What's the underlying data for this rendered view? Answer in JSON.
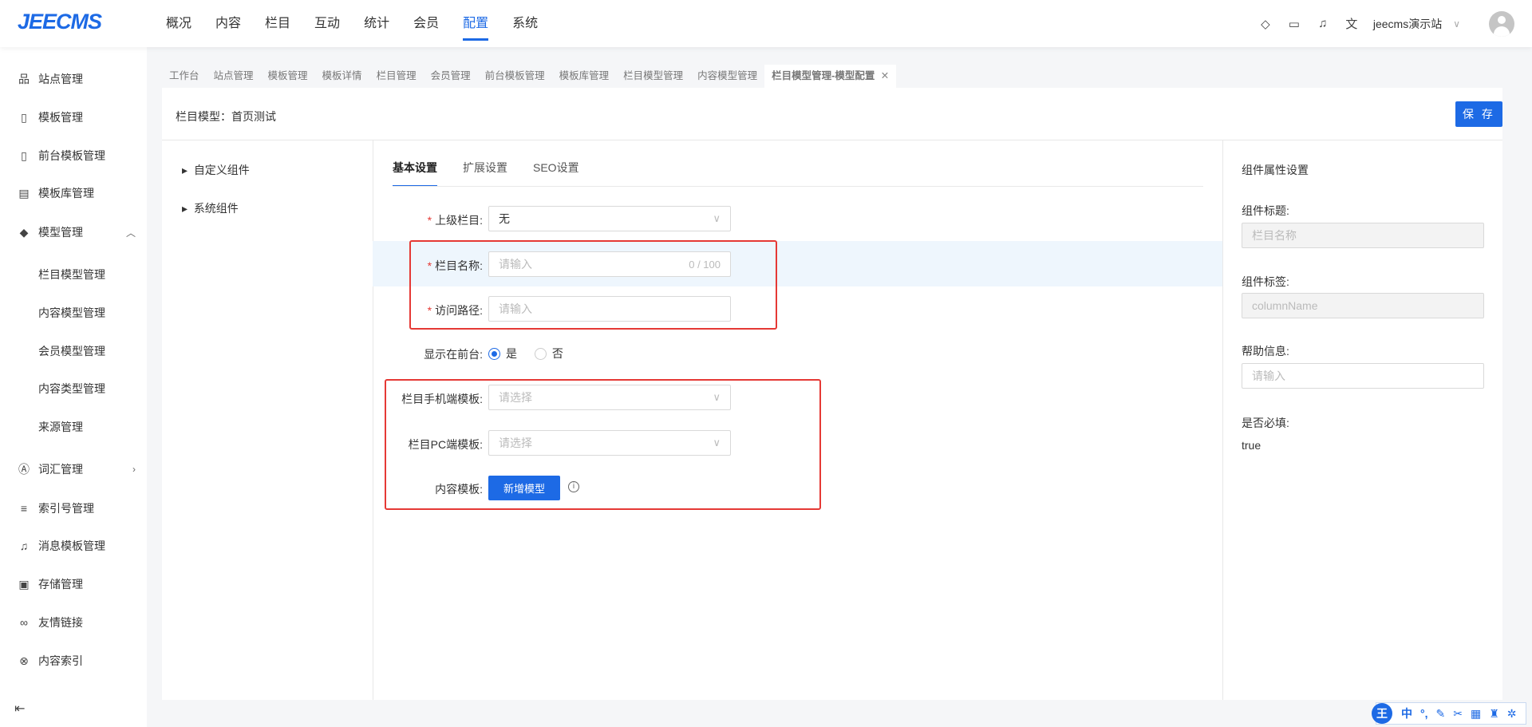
{
  "header": {
    "logo": "JEECMS",
    "nav": [
      "概况",
      "内容",
      "栏目",
      "互动",
      "统计",
      "会员",
      "配置",
      "系统"
    ],
    "active_nav": "配置",
    "icons": [
      "diamond-icon",
      "monitor-icon",
      "bell-icon",
      "translate-icon"
    ],
    "user": "jeecms演示站"
  },
  "sidebar": {
    "items": [
      {
        "label": "站点管理",
        "icon": "sitemap-icon"
      },
      {
        "label": "模板管理",
        "icon": "template-icon"
      },
      {
        "label": "前台模板管理",
        "icon": "template-icon"
      },
      {
        "label": "模板库管理",
        "icon": "library-icon"
      },
      {
        "label": "模型管理",
        "icon": "cube-icon",
        "expanded": true
      },
      {
        "label": "栏目模型管理",
        "sub": true
      },
      {
        "label": "内容模型管理",
        "sub": true
      },
      {
        "label": "会员模型管理",
        "sub": true
      },
      {
        "label": "内容类型管理",
        "sub": true
      },
      {
        "label": "来源管理",
        "sub": true
      },
      {
        "label": "词汇管理",
        "icon": "vocab-icon",
        "arrow": true
      },
      {
        "label": "索引号管理",
        "icon": "index-number-icon"
      },
      {
        "label": "消息模板管理",
        "icon": "bell-icon"
      },
      {
        "label": "存储管理",
        "icon": "storage-icon"
      },
      {
        "label": "友情链接",
        "icon": "link-icon"
      },
      {
        "label": "内容索引",
        "icon": "content-index-icon"
      }
    ]
  },
  "tabs": [
    "工作台",
    "站点管理",
    "模板管理",
    "模板详情",
    "栏目管理",
    "会员管理",
    "前台模板管理",
    "模板库管理",
    "栏目模型管理",
    "内容模型管理",
    "栏目模型管理-模型配置"
  ],
  "page": {
    "title": "栏目模型：首页测试",
    "save": "保 存"
  },
  "tree": [
    "自定义组件",
    "系统组件"
  ],
  "form_tabs": [
    "基本设置",
    "扩展设置",
    "SEO设置"
  ],
  "form": {
    "parent": {
      "label": "上级栏目:",
      "value": "无"
    },
    "name": {
      "label": "栏目名称:",
      "placeholder": "请输入",
      "count": "0 / 100"
    },
    "path": {
      "label": "访问路径:",
      "placeholder": "请输入"
    },
    "show": {
      "label": "显示在前台:",
      "options": [
        "是",
        "否"
      ],
      "selected": "是"
    },
    "mobile_tpl": {
      "label": "栏目手机端模板:",
      "placeholder": "请选择"
    },
    "pc_tpl": {
      "label": "栏目PC端模板:",
      "placeholder": "请选择"
    },
    "content_tpl": {
      "label": "内容模板:",
      "button": "新增模型"
    }
  },
  "props": {
    "heading": "组件属性设置",
    "title_label": "组件标题:",
    "title_value": "栏目名称",
    "tag_label": "组件标签:",
    "tag_value": "columnName",
    "help_label": "帮助信息:",
    "help_placeholder": "请输入",
    "required_label": "是否必填:",
    "required_value": "true"
  },
  "ime": {
    "logo": "王",
    "mode": "中"
  },
  "colors": {
    "accent": "#1d6ae5",
    "highlight": "#e53935"
  }
}
